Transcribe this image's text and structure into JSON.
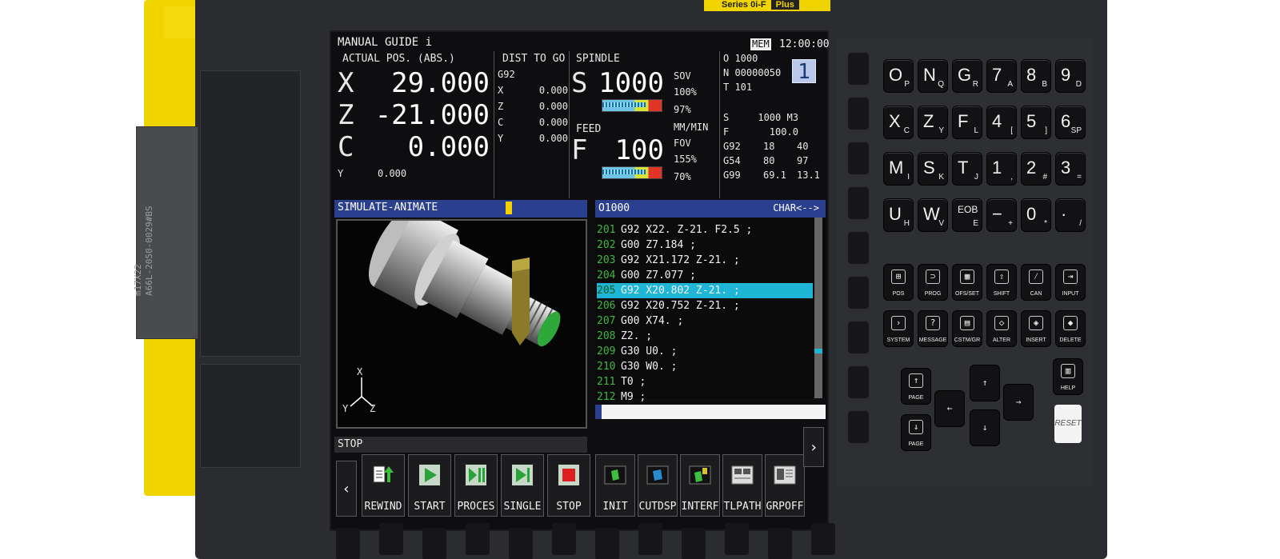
{
  "badge": {
    "series": "Series 0i-F",
    "plus": "Plus"
  },
  "side_label": "m17X22\nA66L-2050-0029#BS",
  "header": {
    "title": "MANUAL GUIDE i",
    "mode": "MEM",
    "time": "12:00:00"
  },
  "position": {
    "label": "ACTUAL POS. (ABS.)",
    "axes": [
      {
        "axis": "X",
        "value": "29.000"
      },
      {
        "axis": "Z",
        "value": "-21.000"
      },
      {
        "axis": "C",
        "value": "0.000"
      }
    ],
    "y_axis": "Y",
    "y_value": "0.000"
  },
  "dist_to_go": {
    "label": "DIST TO GO",
    "gcode": "G92",
    "rows": [
      {
        "axis": "X",
        "value": "0.000"
      },
      {
        "axis": "Z",
        "value": "0.000"
      },
      {
        "axis": "C",
        "value": "0.000"
      },
      {
        "axis": "Y",
        "value": "0.000"
      }
    ]
  },
  "spindle": {
    "label": "SPINDLE",
    "letter": "S",
    "value": "1000",
    "sov_label": "SOV",
    "sov_value": "100%",
    "load": "97%"
  },
  "feed": {
    "label": "FEED",
    "letter": "F",
    "value": "100",
    "unit": "MM/MIN",
    "fov_label": "FOV",
    "fov_value": "155%",
    "load": "70%"
  },
  "modal": {
    "o_line": "O 1000",
    "n_line": "N 00000050",
    "t_line": "T 101",
    "path_num": "1",
    "s_line": "S     1000 M3",
    "f_line": "F       100.0",
    "g_rows": [
      {
        "g": "G92",
        "a": "18",
        "b": "40"
      },
      {
        "g": "G54",
        "a": "80",
        "b": "97"
      },
      {
        "g": "G99",
        "a": "69.1",
        "b": "13.1"
      }
    ]
  },
  "simulation": {
    "title": "SIMULATE-ANIMATE",
    "status": "STOP",
    "axes": {
      "x": "X",
      "y": "Y",
      "z": "Z"
    }
  },
  "program": {
    "name": "O1000",
    "mode": "CHAR<-->",
    "lines": [
      {
        "num": "201",
        "code": "G92 X22. Z-21. F2.5 ;"
      },
      {
        "num": "202",
        "code": "G00 Z7.184 ;"
      },
      {
        "num": "203",
        "code": "G92 X21.172 Z-21. ;"
      },
      {
        "num": "204",
        "code": "G00 Z7.077 ;"
      },
      {
        "num": "205",
        "code": "G92 X20.802 Z-21. ;"
      },
      {
        "num": "206",
        "code": "G92 X20.752 Z-21. ;"
      },
      {
        "num": "207",
        "code": "G00 X74. ;"
      },
      {
        "num": "208",
        "code": "Z2. ;"
      },
      {
        "num": "209",
        "code": "G30 U0. ;"
      },
      {
        "num": "210",
        "code": "G30 W0. ;"
      },
      {
        "num": "211",
        "code": "T0 ;"
      },
      {
        "num": "212",
        "code": "M9 ;"
      }
    ],
    "selected_index": 4
  },
  "softkeys_left": [
    {
      "label": "REWIND",
      "icon": "rewind-icon"
    },
    {
      "label": "START",
      "icon": "play-icon"
    },
    {
      "label": "PROCES",
      "icon": "process-icon"
    },
    {
      "label": "SINGLE",
      "icon": "single-step-icon"
    },
    {
      "label": "STOP",
      "icon": "stop-icon"
    }
  ],
  "softkeys_right": [
    {
      "label": "INIT",
      "icon": "init-icon"
    },
    {
      "label": "CUTDSP",
      "icon": "cut-display-icon"
    },
    {
      "label": "INTERF",
      "icon": "interference-icon"
    },
    {
      "label": "TLPATH",
      "icon": "tool-path-icon"
    },
    {
      "label": "GRPOFF",
      "icon": "graph-off-icon"
    }
  ],
  "nav": {
    "prev": "‹",
    "next": "›"
  },
  "keypad": {
    "rows": [
      [
        {
          "m": "O",
          "s": "P"
        },
        {
          "m": "N",
          "s": "Q"
        },
        {
          "m": "G",
          "s": "R"
        },
        {
          "m": "7",
          "s": "A"
        },
        {
          "m": "8",
          "s": "B"
        },
        {
          "m": "9",
          "s": "D"
        }
      ],
      [
        {
          "m": "X",
          "s": "C"
        },
        {
          "m": "Z",
          "s": "Y"
        },
        {
          "m": "F",
          "s": "L"
        },
        {
          "m": "4",
          "s": "["
        },
        {
          "m": "5",
          "s": "]"
        },
        {
          "m": "6",
          "s": "SP"
        }
      ],
      [
        {
          "m": "M",
          "s": "I"
        },
        {
          "m": "S",
          "s": "K"
        },
        {
          "m": "T",
          "s": "J"
        },
        {
          "m": "1",
          "s": ","
        },
        {
          "m": "2",
          "s": "#"
        },
        {
          "m": "3",
          "s": "="
        }
      ],
      [
        {
          "m": "U",
          "s": "H"
        },
        {
          "m": "W",
          "s": "V"
        },
        {
          "m": "EOB",
          "s": "E"
        },
        {
          "m": "−",
          "s": "+"
        },
        {
          "m": "0",
          "s": "*"
        },
        {
          "m": "·",
          "s": "/"
        }
      ]
    ],
    "func_rows": [
      [
        {
          "l": "POS",
          "i": "⊞"
        },
        {
          "l": "PROG",
          "i": "⊃"
        },
        {
          "l": "OFS/SET",
          "i": "▦"
        },
        {
          "l": "SHIFT",
          "i": "⇧"
        },
        {
          "l": "CAN",
          "i": "⁄"
        },
        {
          "l": "INPUT",
          "i": "⇥"
        }
      ],
      [
        {
          "l": "SYSTEM",
          "i": "›"
        },
        {
          "l": "MESSAGE",
          "i": "?"
        },
        {
          "l": "CSTM/GR",
          "i": "▤"
        },
        {
          "l": "ALTER",
          "i": "◇"
        },
        {
          "l": "INSERT",
          "i": "◈"
        },
        {
          "l": "DELETE",
          "i": "◆"
        }
      ]
    ],
    "page_up": "PAGE",
    "page_down": "PAGE",
    "help": "HELP",
    "reset": "RESET"
  }
}
